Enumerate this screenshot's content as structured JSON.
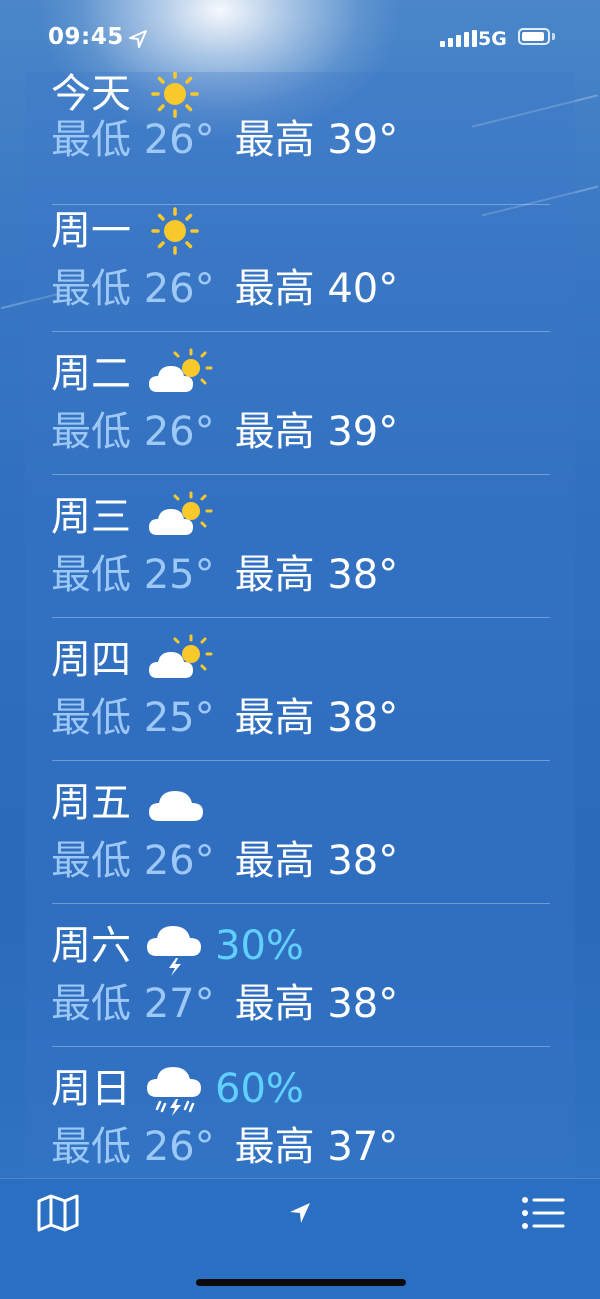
{
  "status": {
    "time": "09:45",
    "network": "5G"
  },
  "forecast": [
    {
      "day": "今天",
      "icon": "sun-icon",
      "precip": "",
      "low": "最低 26°",
      "high": "最高 39°"
    },
    {
      "day": "周一",
      "icon": "sun-icon",
      "precip": "",
      "low": "最低 26°",
      "high": "最高 40°"
    },
    {
      "day": "周二",
      "icon": "partly-cloudy-icon",
      "precip": "",
      "low": "最低 26°",
      "high": "最高 39°"
    },
    {
      "day": "周三",
      "icon": "partly-cloudy-icon",
      "precip": "",
      "low": "最低 25°",
      "high": "最高 38°"
    },
    {
      "day": "周四",
      "icon": "partly-cloudy-icon",
      "precip": "",
      "low": "最低 25°",
      "high": "最高 38°"
    },
    {
      "day": "周五",
      "icon": "cloud-icon",
      "precip": "",
      "low": "最低 26°",
      "high": "最高 38°"
    },
    {
      "day": "周六",
      "icon": "thunderstorm-icon",
      "precip": "30%",
      "low": "最低 27°",
      "high": "最高 38°"
    },
    {
      "day": "周日",
      "icon": "thunder-rain-icon",
      "precip": "60%",
      "low": "最低 26°",
      "high": "最高 37°"
    }
  ],
  "tabbar": {
    "items": [
      "map-icon",
      "location-arrow-icon",
      "list-icon"
    ]
  },
  "colors": {
    "precip": "#5fd0ff",
    "sun": "#f9c92b",
    "background": "#2f6fbf"
  }
}
